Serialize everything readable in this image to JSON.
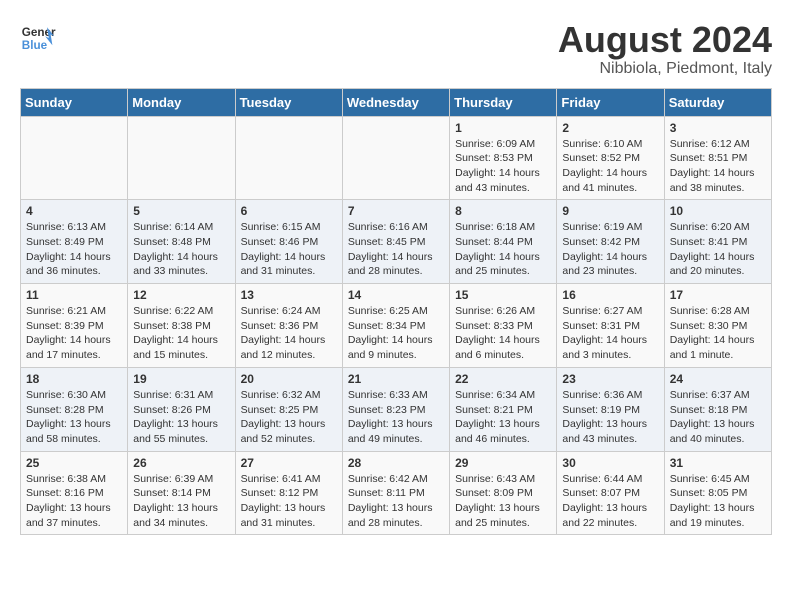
{
  "logo": {
    "line1": "General",
    "line2": "Blue"
  },
  "title": "August 2024",
  "location": "Nibbiola, Piedmont, Italy",
  "days_of_week": [
    "Sunday",
    "Monday",
    "Tuesday",
    "Wednesday",
    "Thursday",
    "Friday",
    "Saturday"
  ],
  "weeks": [
    [
      {
        "day": "",
        "info": ""
      },
      {
        "day": "",
        "info": ""
      },
      {
        "day": "",
        "info": ""
      },
      {
        "day": "",
        "info": ""
      },
      {
        "day": "1",
        "info": "Sunrise: 6:09 AM\nSunset: 8:53 PM\nDaylight: 14 hours and 43 minutes."
      },
      {
        "day": "2",
        "info": "Sunrise: 6:10 AM\nSunset: 8:52 PM\nDaylight: 14 hours and 41 minutes."
      },
      {
        "day": "3",
        "info": "Sunrise: 6:12 AM\nSunset: 8:51 PM\nDaylight: 14 hours and 38 minutes."
      }
    ],
    [
      {
        "day": "4",
        "info": "Sunrise: 6:13 AM\nSunset: 8:49 PM\nDaylight: 14 hours and 36 minutes."
      },
      {
        "day": "5",
        "info": "Sunrise: 6:14 AM\nSunset: 8:48 PM\nDaylight: 14 hours and 33 minutes."
      },
      {
        "day": "6",
        "info": "Sunrise: 6:15 AM\nSunset: 8:46 PM\nDaylight: 14 hours and 31 minutes."
      },
      {
        "day": "7",
        "info": "Sunrise: 6:16 AM\nSunset: 8:45 PM\nDaylight: 14 hours and 28 minutes."
      },
      {
        "day": "8",
        "info": "Sunrise: 6:18 AM\nSunset: 8:44 PM\nDaylight: 14 hours and 25 minutes."
      },
      {
        "day": "9",
        "info": "Sunrise: 6:19 AM\nSunset: 8:42 PM\nDaylight: 14 hours and 23 minutes."
      },
      {
        "day": "10",
        "info": "Sunrise: 6:20 AM\nSunset: 8:41 PM\nDaylight: 14 hours and 20 minutes."
      }
    ],
    [
      {
        "day": "11",
        "info": "Sunrise: 6:21 AM\nSunset: 8:39 PM\nDaylight: 14 hours and 17 minutes."
      },
      {
        "day": "12",
        "info": "Sunrise: 6:22 AM\nSunset: 8:38 PM\nDaylight: 14 hours and 15 minutes."
      },
      {
        "day": "13",
        "info": "Sunrise: 6:24 AM\nSunset: 8:36 PM\nDaylight: 14 hours and 12 minutes."
      },
      {
        "day": "14",
        "info": "Sunrise: 6:25 AM\nSunset: 8:34 PM\nDaylight: 14 hours and 9 minutes."
      },
      {
        "day": "15",
        "info": "Sunrise: 6:26 AM\nSunset: 8:33 PM\nDaylight: 14 hours and 6 minutes."
      },
      {
        "day": "16",
        "info": "Sunrise: 6:27 AM\nSunset: 8:31 PM\nDaylight: 14 hours and 3 minutes."
      },
      {
        "day": "17",
        "info": "Sunrise: 6:28 AM\nSunset: 8:30 PM\nDaylight: 14 hours and 1 minute."
      }
    ],
    [
      {
        "day": "18",
        "info": "Sunrise: 6:30 AM\nSunset: 8:28 PM\nDaylight: 13 hours and 58 minutes."
      },
      {
        "day": "19",
        "info": "Sunrise: 6:31 AM\nSunset: 8:26 PM\nDaylight: 13 hours and 55 minutes."
      },
      {
        "day": "20",
        "info": "Sunrise: 6:32 AM\nSunset: 8:25 PM\nDaylight: 13 hours and 52 minutes."
      },
      {
        "day": "21",
        "info": "Sunrise: 6:33 AM\nSunset: 8:23 PM\nDaylight: 13 hours and 49 minutes."
      },
      {
        "day": "22",
        "info": "Sunrise: 6:34 AM\nSunset: 8:21 PM\nDaylight: 13 hours and 46 minutes."
      },
      {
        "day": "23",
        "info": "Sunrise: 6:36 AM\nSunset: 8:19 PM\nDaylight: 13 hours and 43 minutes."
      },
      {
        "day": "24",
        "info": "Sunrise: 6:37 AM\nSunset: 8:18 PM\nDaylight: 13 hours and 40 minutes."
      }
    ],
    [
      {
        "day": "25",
        "info": "Sunrise: 6:38 AM\nSunset: 8:16 PM\nDaylight: 13 hours and 37 minutes."
      },
      {
        "day": "26",
        "info": "Sunrise: 6:39 AM\nSunset: 8:14 PM\nDaylight: 13 hours and 34 minutes."
      },
      {
        "day": "27",
        "info": "Sunrise: 6:41 AM\nSunset: 8:12 PM\nDaylight: 13 hours and 31 minutes."
      },
      {
        "day": "28",
        "info": "Sunrise: 6:42 AM\nSunset: 8:11 PM\nDaylight: 13 hours and 28 minutes."
      },
      {
        "day": "29",
        "info": "Sunrise: 6:43 AM\nSunset: 8:09 PM\nDaylight: 13 hours and 25 minutes."
      },
      {
        "day": "30",
        "info": "Sunrise: 6:44 AM\nSunset: 8:07 PM\nDaylight: 13 hours and 22 minutes."
      },
      {
        "day": "31",
        "info": "Sunrise: 6:45 AM\nSunset: 8:05 PM\nDaylight: 13 hours and 19 minutes."
      }
    ]
  ]
}
